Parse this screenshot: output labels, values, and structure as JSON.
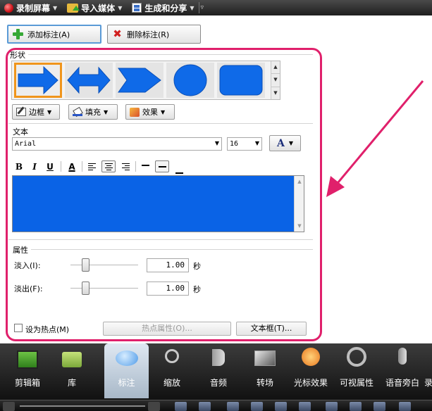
{
  "toolbar": {
    "record": "录制屏幕",
    "import": "导入媒体",
    "produce": "生成和分享"
  },
  "actions": {
    "add": "添加标注(A)",
    "delete": "删除标注(R)"
  },
  "shape": {
    "label": "形状",
    "border": "边框",
    "fill": "填充",
    "effect": "效果",
    "shapes": [
      "right-arrow",
      "double-arrow",
      "chevron-arrow",
      "circle",
      "rounded-rectangle"
    ],
    "fill_color": "#0f6ae8"
  },
  "text": {
    "label": "文本",
    "font": "Arial",
    "size": "16",
    "color_glyph": "A",
    "bold": "B",
    "italic": "I",
    "underline": "U",
    "font_color_glyph": "A",
    "box_color": "#0a63e6"
  },
  "properties": {
    "label": "属性",
    "fade_in": "淡入(I):",
    "fade_in_value": "1.00",
    "fade_out": "淡出(F):",
    "fade_out_value": "1.00",
    "unit": "秒",
    "hotspot": "设为热点(M)",
    "hotspot_props": "热点属性(O)...",
    "textbox": "文本框(T)..."
  },
  "dock": {
    "items": [
      "剪辑箱",
      "库",
      "标注",
      "缩放",
      "音频",
      "转场",
      "光标效果",
      "可视属性",
      "语音旁白",
      "录"
    ]
  },
  "accent": "#e0206b"
}
